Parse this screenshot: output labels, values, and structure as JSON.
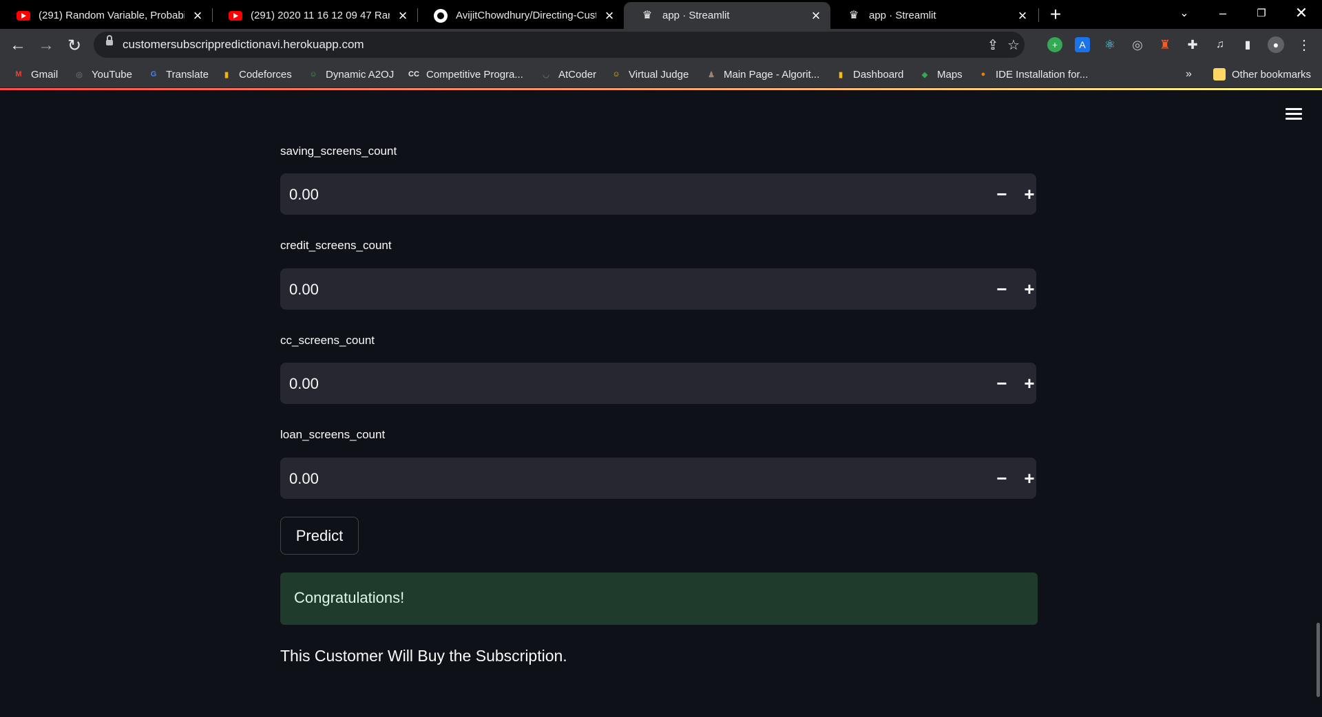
{
  "browser": {
    "tabs": [
      {
        "title": "(291) Random Variable, Probabili",
        "icon": "youtube-icon"
      },
      {
        "title": "(291) 2020 11 16 12 09 47 Random",
        "icon": "youtube-icon"
      },
      {
        "title": "AvijitChowdhury/Directing-Custo",
        "icon": "github-icon"
      },
      {
        "title": "app · Streamlit",
        "icon": "streamlit-crown-icon",
        "active": true
      },
      {
        "title": "app · Streamlit",
        "icon": "streamlit-crown-icon"
      }
    ],
    "url": "customersubscrippredictionavi.herokuapp.com",
    "bookmarks": [
      {
        "label": "Gmail",
        "color": "#ea4335",
        "glyph": "M"
      },
      {
        "label": "YouTube",
        "color": "#5f6368",
        "glyph": "◎"
      },
      {
        "label": "Translate",
        "color": "#4285f4",
        "glyph": "G"
      },
      {
        "label": "Codeforces",
        "color": "#f4b400",
        "glyph": "▮"
      },
      {
        "label": "Dynamic A2OJ",
        "color": "#34a853",
        "glyph": "☺"
      },
      {
        "label": "Competitive Progra...",
        "color": "#e8eaed",
        "glyph": "CC"
      },
      {
        "label": "AtCoder",
        "color": "#5f6368",
        "glyph": "◡"
      },
      {
        "label": "Virtual Judge",
        "color": "#fbbc04",
        "glyph": "☺"
      },
      {
        "label": "Main Page - Algorit...",
        "color": "#a0826d",
        "glyph": "♟"
      },
      {
        "label": "Dashboard",
        "color": "#fbbc04",
        "glyph": "▮"
      },
      {
        "label": "Maps",
        "color": "#34a853",
        "glyph": "◆"
      },
      {
        "label": "IDE Installation for...",
        "color": "#f57c00",
        "glyph": "●"
      }
    ],
    "more_bookmarks": "»",
    "other_bookmarks": "Other bookmarks"
  },
  "app": {
    "fields": [
      {
        "label": "saving_screens_count",
        "value": "0.00"
      },
      {
        "label": "credit_screens_count",
        "value": "0.00"
      },
      {
        "label": "cc_screens_count",
        "value": "0.00"
      },
      {
        "label": "loan_screens_count",
        "value": "0.00"
      }
    ],
    "minus": "−",
    "plus": "+",
    "predict_label": "Predict",
    "success_message": "Congratulations!",
    "result_text": "This Customer Will Buy the Subscription."
  },
  "colors": {
    "background": "#0e1117",
    "input_bg": "#262730",
    "success_bg": "#1e3b2c",
    "accent": "#ff4b4b"
  }
}
